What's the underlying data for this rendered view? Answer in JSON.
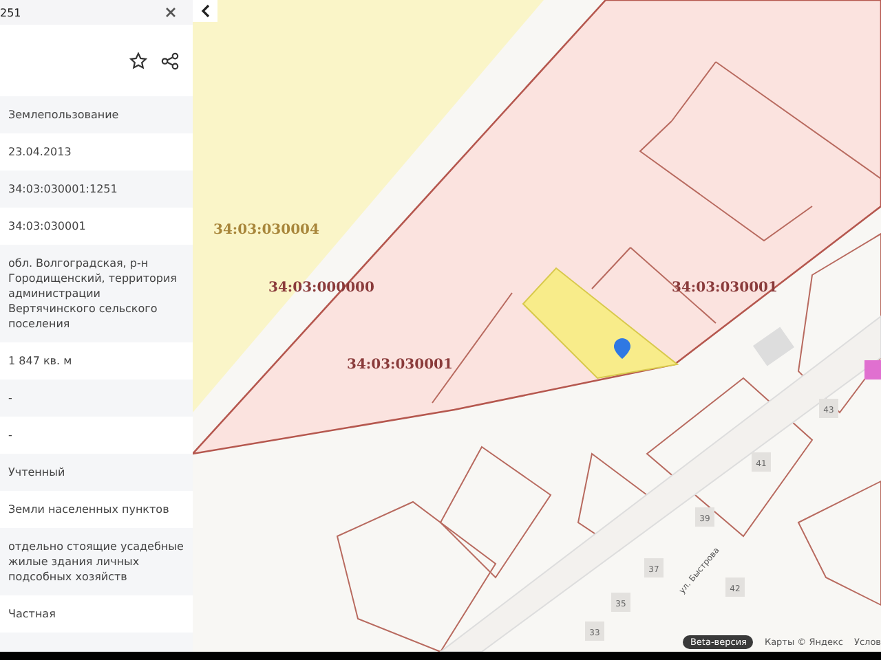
{
  "search": {
    "value": "251"
  },
  "fields": [
    "Землепользование",
    "23.04.2013",
    "34:03:030001:1251",
    "34:03:030001",
    "обл. Волгоградская, р-н Городищенский, территория администрации Вертячинского сельского поселения",
    "1 847 кв. м",
    "-",
    "-",
    "Учтенный",
    "Земли населенных пунктов",
    "отдельно стоящие усадебные жилые здания личных подсобных хозяйств",
    "Частная"
  ],
  "map": {
    "quarter_labels": [
      "34:03:030004",
      "34:03:000000",
      "34:03:030001",
      "34:03:030001"
    ],
    "house_numbers": [
      "43",
      "41",
      "39",
      "37",
      "35",
      "33",
      "42"
    ],
    "street": "ул. Быстрова",
    "beta": "Beta-версия",
    "copyright": "Карты © Яндекс",
    "terms": "Услов"
  }
}
